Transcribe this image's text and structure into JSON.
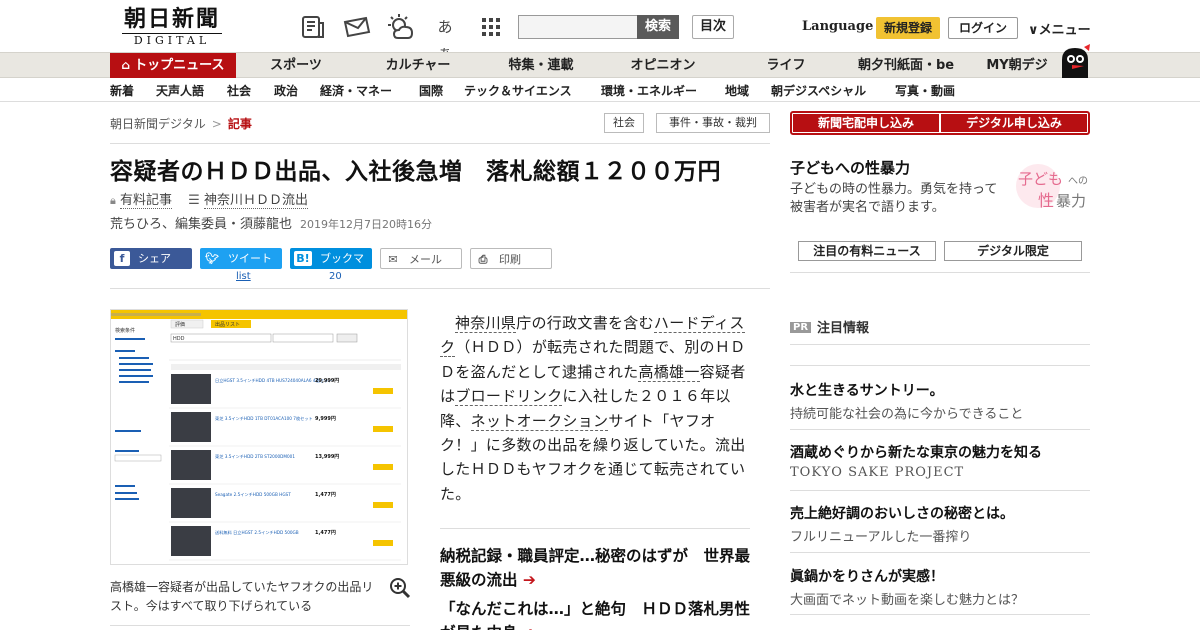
{
  "header": {
    "logo_main": "朝日新聞",
    "logo_sub": "DIGITAL",
    "search_button": "検索",
    "contents_button": "目次",
    "language": "Language",
    "register": "新規登録",
    "login": "ログイン",
    "menu": "メニュー",
    "icons": [
      "newspaper-icon",
      "news-mail-icon",
      "weather-icon",
      "font-size-icon",
      "grid-menu-icon"
    ]
  },
  "nav1": [
    "トップニュース",
    "スポーツ",
    "カルチャー",
    "特集・連載",
    "オピニオン",
    "ライフ",
    "朝夕刊紙面・be",
    "MY朝デジ"
  ],
  "nav2": [
    "新着",
    "天声人語",
    "社会",
    "政治",
    "経済・マネー",
    "国際",
    "テック＆サイエンス",
    "環境・エネルギー",
    "地域",
    "朝デジスペシャル",
    "写真・動画"
  ],
  "breadcrumb": {
    "home": "朝日新聞デジタル",
    "sep": ">",
    "current": "記事",
    "tags": [
      "社会",
      "事件・事故・裁判"
    ]
  },
  "article": {
    "headline": "容疑者のＨＤＤ出品、入社後急増　落札総額１２００万円",
    "paid_label": "有料記事",
    "series_label": "神奈川ＨＤＤ流出",
    "byline": "荒ちひろ、編集委員・須藤龍也",
    "date": "2019年12月7日20時16分",
    "share": {
      "facebook": "シェア",
      "twitter": "ツイート",
      "twitter_sub": "list",
      "hatena": "ブックマーク",
      "hatena_count": "20",
      "mail": "メール",
      "print": "印刷"
    },
    "caption": "高橋雄一容疑者が出品していたヤフオクの出品リスト。今はすべて取り下げられている",
    "body": {
      "p1_link1": "神奈川県",
      "p1_t1": "庁の行政文書を含む",
      "p1_link2": "ハードディスク",
      "p1_t2": "（ＨＤＤ）が転売された問題で、別のＨＤＤを盗んだとして逮捕された",
      "p1_link3": "高橋雄一",
      "p1_t3": "容疑者は",
      "p1_link4": "ブロードリンク",
      "p1_t4": "に入社した２０１６年以降、",
      "p1_link5": "ネットオークション",
      "p1_t5": "サイト「ヤフオク！」に多数の出品を繰り返していた。流出したＨＤＤもヤフオクを通じて転売されていた。"
    },
    "related": [
      "納税記録・職員評定…秘密のはずが　世界最悪級の流出",
      "「なんだこれは…」と絶句　ＨＤＤ落札男性が見た中身"
    ]
  },
  "photo": {
    "tabs": [
      "評価",
      "出品リスト"
    ],
    "sidebar_title": "検索条件",
    "query": "HDD",
    "items": [
      {
        "title": "日立HGST 3.5インチHDD 4TB HUS724040ALA6 4個セット",
        "price": "29,999円"
      },
      {
        "title": "東芝 3.5インチHDD 1TB DT01ACA100 7枚セット",
        "price": "9,999円"
      },
      {
        "title": "東芝 3.5インチHDD 2TB ST2000DM001",
        "price": "13,999円"
      },
      {
        "title": "Seagate 2.5インチHDD 500GB HGST",
        "price": "1,477円"
      },
      {
        "title": "送料無料 日立HGST 2.5インチHDD 500GB",
        "price": "1,477円"
      }
    ]
  },
  "sidebar": {
    "apply1": "新聞宅配申し込み",
    "apply2": "デジタル申し込み",
    "feature_title": "子どもへの性暴力",
    "feature_desc": "子どもの時の性暴力。勇気を持って被害者が実名で語ります。",
    "feature_img_text1": "子ども",
    "feature_img_text2": "への",
    "feature_img_text3": "性",
    "feature_img_text4": "暴力",
    "btn1": "注目の有料ニュース",
    "btn2": "デジタル限定",
    "pr_badge": "PR",
    "pr_label": "注目情報",
    "pr_items": [
      {
        "title": "水と生きるサントリー。",
        "sub": "持続可能な社会の為に今からできること"
      },
      {
        "title": "酒蔵めぐりから新たな東京の魅力を知る",
        "sub": "TOKYO SAKE PROJECT"
      },
      {
        "title": "売上絶好調のおいしさの秘密とは。",
        "sub": "フルリニューアルした一番搾り"
      },
      {
        "title": "眞鍋かをりさんが実感！",
        "sub": "大画面でネット動画を楽しむ魅力とは？"
      }
    ]
  },
  "colors": {
    "brand_red": "#b70f12",
    "register_yellow": "#f1c232",
    "facebook": "#3b5998",
    "twitter": "#1da1f2",
    "hatena": "#008fde"
  }
}
